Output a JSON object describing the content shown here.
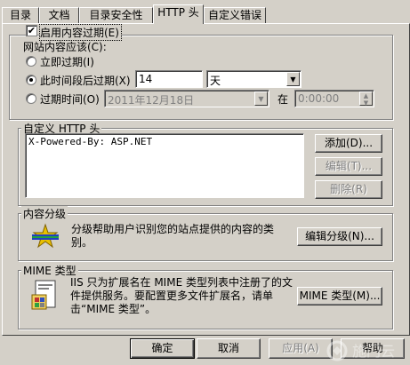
{
  "tabs": [
    "目录",
    "文档",
    "目录安全性",
    "HTTP 头",
    "自定义错误"
  ],
  "expiry": {
    "enable_label": "启用内容过期(E)",
    "prompt": "网站内容应该(C):",
    "immediately": "立即过期(I)",
    "after_label": "此时间段后过期(X)",
    "after_value": "14",
    "unit_value": "天",
    "on_label": "过期时间(O)",
    "date_value": "2011年12月18日",
    "at_label": "在",
    "time_value": "0:00:00"
  },
  "custom_headers": {
    "title": "自定义 HTTP 头",
    "items": [
      "X-Powered-By: ASP.NET"
    ],
    "add": "添加(D)...",
    "edit": "编辑(T)...",
    "delete": "删除(R)"
  },
  "rating": {
    "title": "内容分级",
    "description": "分级帮助用户识别您的站点提供的内容的类别。",
    "edit": "编辑分级(N)..."
  },
  "mime": {
    "title": "MIME 类型",
    "description": "IIS 只为扩展名在 MIME 类型列表中注册了的文件提供服务。要配置更多文件扩展名，请单击“MIME 类型”。",
    "button": "MIME 类型(M)..."
  },
  "footer": {
    "ok": "确定",
    "cancel": "取消",
    "apply": "应用(A)",
    "help": "帮助"
  },
  "watermark": "施门云"
}
